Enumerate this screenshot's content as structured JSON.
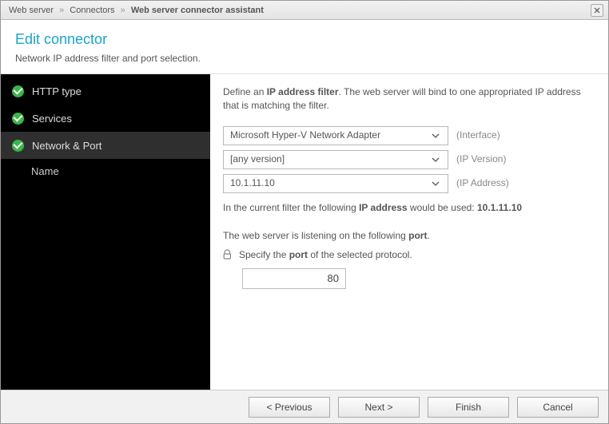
{
  "breadcrumb": {
    "part1": "Web server",
    "part2": "Connectors",
    "part3": "Web server connector assistant",
    "sep": "»"
  },
  "header": {
    "title": "Edit connector",
    "subtitle": "Network IP address filter and port selection."
  },
  "sidebar": {
    "items": [
      {
        "label": "HTTP type"
      },
      {
        "label": "Services"
      },
      {
        "label": "Network & Port"
      }
    ],
    "sub": {
      "label": "Name"
    }
  },
  "content": {
    "intro_pre": "Define an ",
    "intro_bold": "IP address filter",
    "intro_post": ". The web server will bind to one appropriated IP address that is matching the filter.",
    "interface_value": "Microsoft Hyper-V Network Adapter",
    "interface_label": "(Interface)",
    "ipversion_value": "[any version]",
    "ipversion_label": "(IP Version)",
    "ipaddress_value": "10.1.11.10",
    "ipaddress_label": "(IP Address)",
    "result_pre": "In the current filter the following ",
    "result_bold1": "IP address",
    "result_mid": " would be used: ",
    "result_bold2": "10.1.11.10",
    "port_line_pre": "The web server is listening on the following ",
    "port_line_bold": "port",
    "port_line_post": ".",
    "port_spec_pre": "Specify the ",
    "port_spec_bold": "port",
    "port_spec_post": " of the selected protocol.",
    "port_value": "80"
  },
  "footer": {
    "previous": "< Previous",
    "next": "Next >",
    "finish": "Finish",
    "cancel": "Cancel"
  }
}
